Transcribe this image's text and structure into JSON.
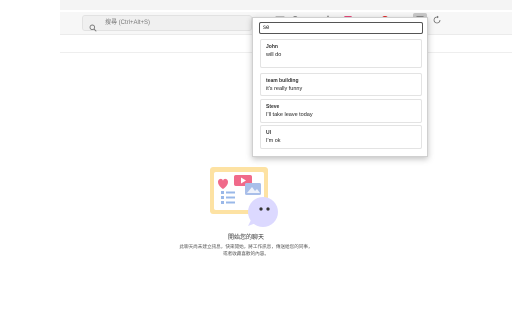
{
  "toolbar": {
    "search_placeholder": "搜尋 (Ctrl+Alt+S)",
    "icons": [
      "image-icon",
      "zoom-icon",
      "read-aloud-icon",
      "favorite-star-icon",
      "extension-pink-icon",
      "extension-gray-icon",
      "opera-icon",
      "bold-b-icon",
      "extension-active-icon",
      "refresh-icon"
    ]
  },
  "popup": {
    "search_value": "se",
    "results": [
      {
        "name": "John",
        "message": "will do"
      },
      {
        "name": "team building",
        "message": "it's really funny"
      },
      {
        "name": "Steve",
        "message": "I'll take leave today"
      },
      {
        "name": "UI",
        "message": "I'm ok"
      }
    ]
  },
  "empty_state": {
    "title": "開始您的聊天",
    "description_line1": "此聊天尚未建立訊息，快來開始，將工作訊息，傳送給您的同事，",
    "description_line2": "或者收藏喜歡的內容。"
  },
  "colors": {
    "accent_pink": "#f06a8a",
    "popup_border": "#d0d0d0",
    "bubble": "#dcd9ff"
  }
}
